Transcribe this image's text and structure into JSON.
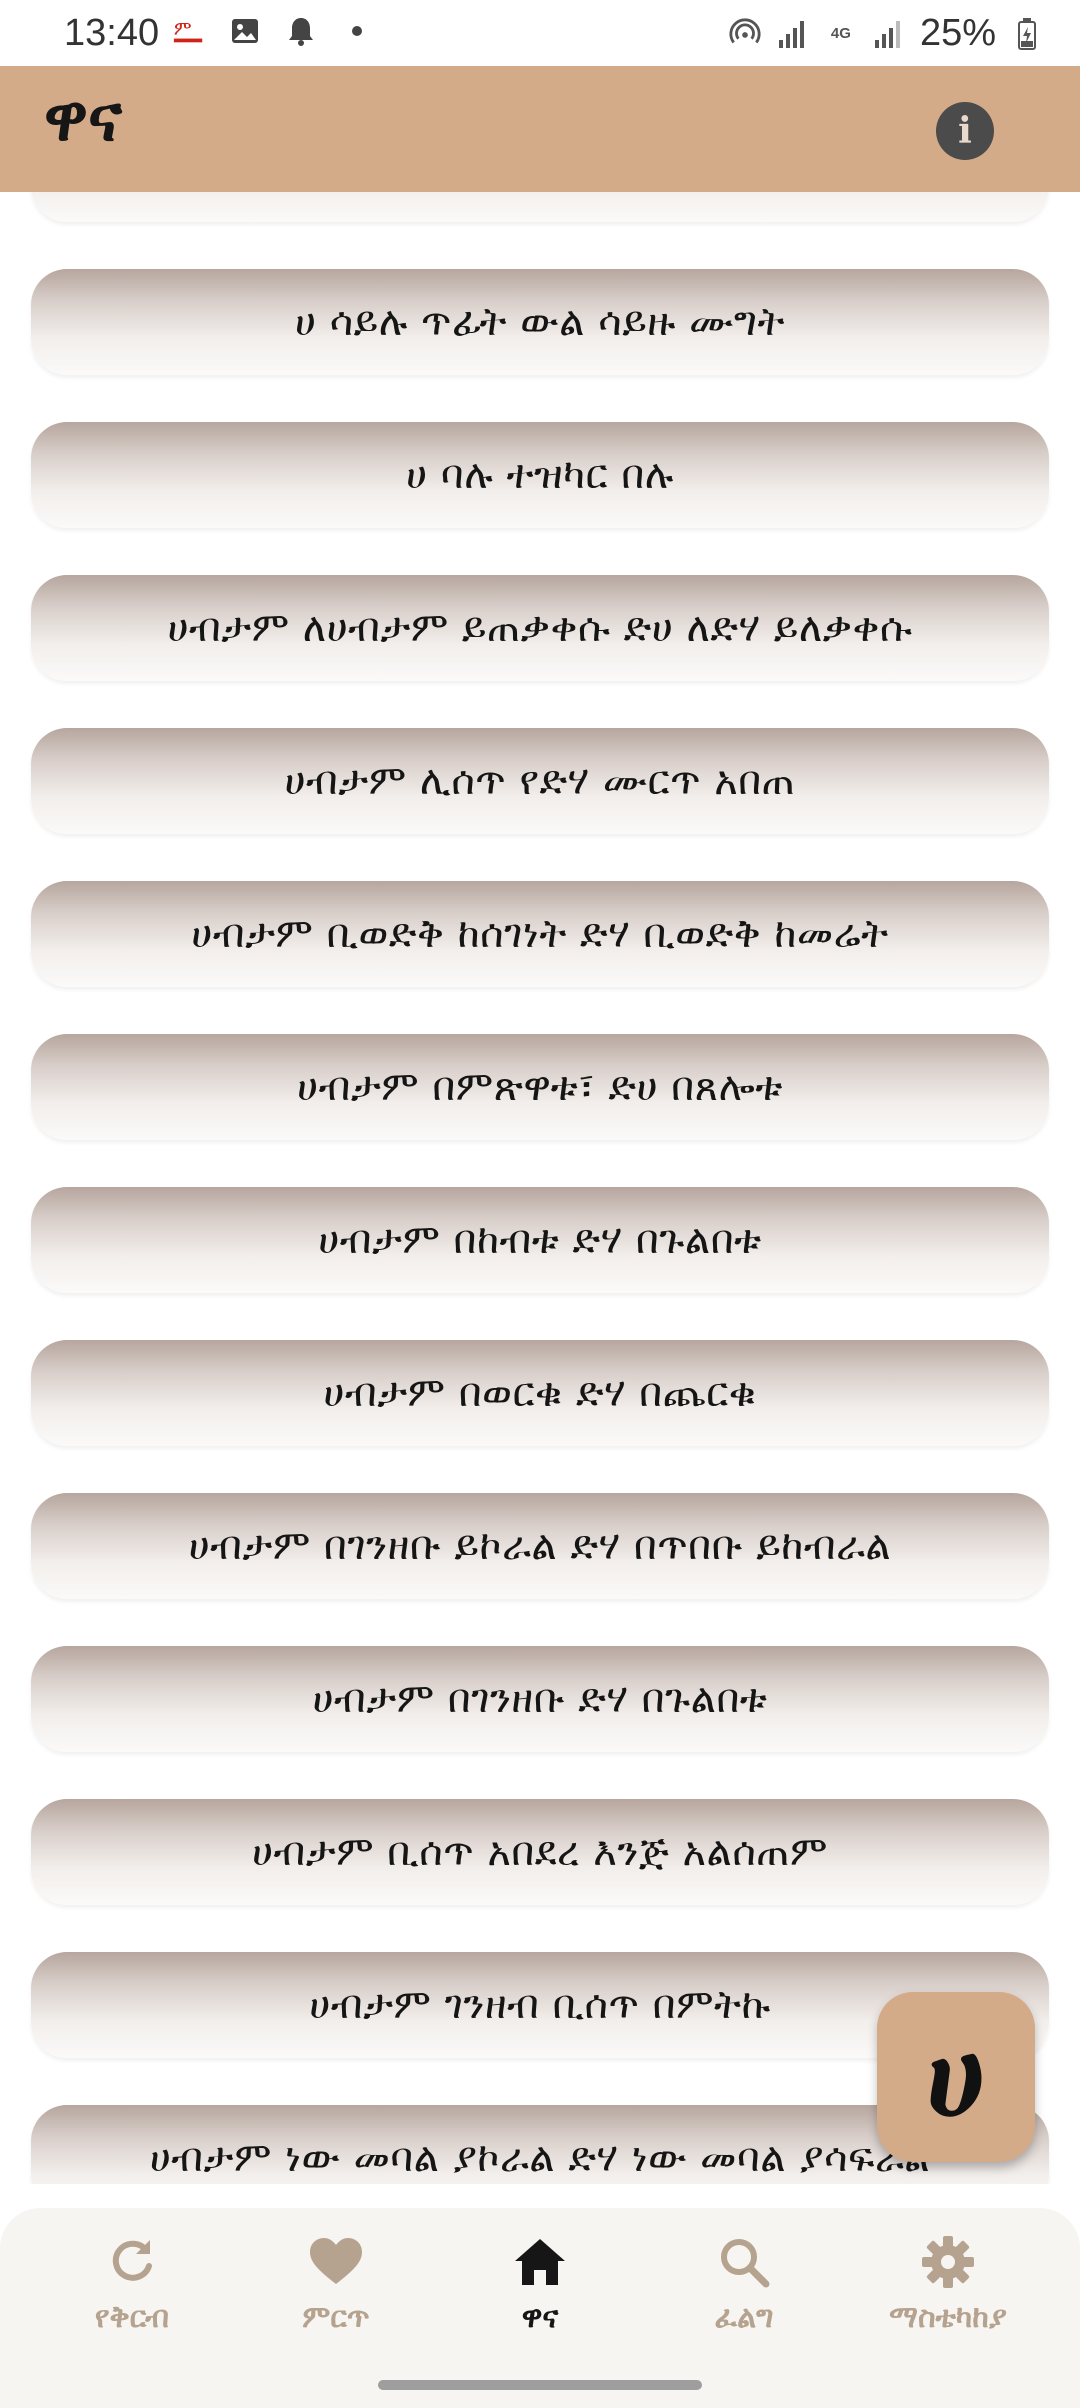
{
  "status_bar": {
    "time": "13:40",
    "battery": "25%",
    "network": "4G",
    "icons": [
      "carrier-logo-icon",
      "gallery-icon",
      "bell-icon",
      "dot-icon",
      "hotspot-icon",
      "signal-icon",
      "signal-icon-2",
      "battery-icon"
    ]
  },
  "app_bar": {
    "title": "ዋና",
    "info_icon": "i"
  },
  "list": {
    "items": [
      "ሀ ሳይሉ ጥፊት ውል ሳይዙ ሙግት",
      "ሀ ባሉ ተዝካር በሉ",
      "ሀብታም ለሀብታም ይጠቃቀሱ ድሀ ለድሃ ይለቃቀሱ",
      "ሀብታም ሊሰጥ የድሃ ሙርጥ አበጠ",
      "ሀብታም ቢወድቅ ከሰገነት ድሃ ቢወድቅ ከመሬት",
      "ሀብታም በምጽዋቱ፣ ድሀ በጸሎቱ",
      "ሀብታም በከብቱ ድሃ በጉልበቱ",
      "ሀብታም በወርቁ ድሃ በጨርቁ",
      "ሀብታም በገንዘቡ ይኮራል ድሃ በጥበቡ ይከብራል",
      "ሀብታም በገንዘቡ ድሃ በጉልበቱ",
      "ሀብታም ቢሰጥ አበደረ እንጅ አልሰጠም",
      "ሀብታም ገንዘብ ቢሰጥ በምትኩ",
      "ሀብታም ነው መባል ያኮራል ድሃ ነው መባል ያሳፍራል"
    ]
  },
  "fab": {
    "letter": "ሀ"
  },
  "bottom_nav": {
    "items": [
      {
        "label": "የቅርብ",
        "icon": "refresh-icon"
      },
      {
        "label": "ምርጥ",
        "icon": "heart-icon"
      },
      {
        "label": "ዋና",
        "icon": "home-icon",
        "active": true
      },
      {
        "label": "ፈልግ",
        "icon": "search-icon"
      },
      {
        "label": "ማስቴካከያ",
        "icon": "gear-icon"
      }
    ]
  },
  "colors": {
    "accent": "#d3ab89",
    "nav_inactive": "#b5a38f",
    "nav_active": "#161616"
  }
}
